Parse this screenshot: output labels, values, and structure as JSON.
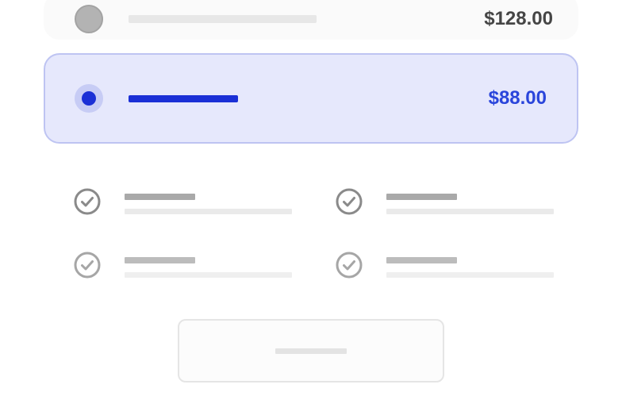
{
  "plans": [
    {
      "name": "plan-option-1",
      "price": "$128.00",
      "selected": false
    },
    {
      "name": "plan-option-2",
      "price": "$88.00",
      "selected": true
    }
  ],
  "features": [
    {
      "icon": "check-circle-icon"
    },
    {
      "icon": "check-circle-icon"
    },
    {
      "icon": "check-circle-icon"
    },
    {
      "icon": "check-circle-icon"
    }
  ],
  "colors": {
    "accent": "#1a2fd6",
    "accent_price": "#2a45db",
    "selected_background": "#e6e8fc",
    "selected_border": "#bec4f2",
    "muted_text": "#454545",
    "icon_gray": "#8a8a8a"
  }
}
